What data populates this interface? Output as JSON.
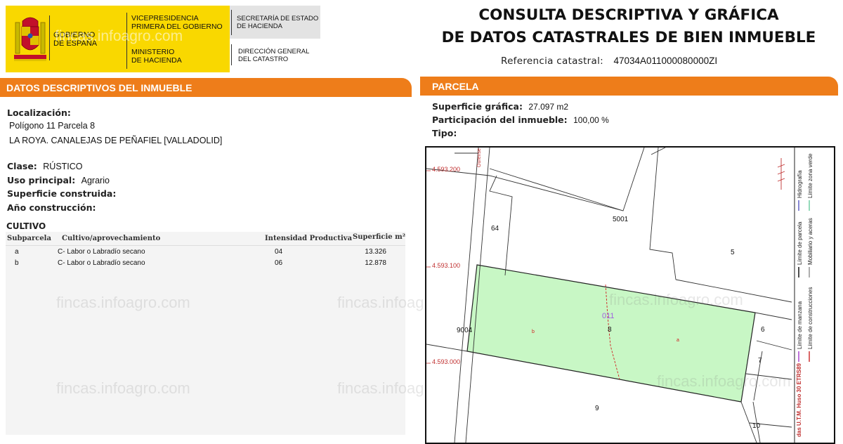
{
  "logo": {
    "gobierno_1": "GOBIERNO",
    "gobierno_2": "DE ESPAÑA",
    "vice_1": "VICEPRESIDENCIA",
    "vice_2": "PRIMERA DEL GOBIERNO",
    "min_1": "MINISTERIO",
    "min_2": "DE HACIENDA",
    "secr_1": "SECRETARÍA DE ESTADO",
    "secr_2": "DE HACIENDA",
    "dir_1": "DIRECCIÓN GENERAL",
    "dir_2": "DEL CATASTRO",
    "watermark": "fincas.infoagro.com"
  },
  "header": {
    "title_1": "CONSULTA DESCRIPTIVA Y GRÁFICA",
    "title_2": "DE DATOS CATASTRALES DE BIEN INMUEBLE",
    "ref_label": "Referencia catastral:",
    "ref_value": "47034A011000080000ZI"
  },
  "descriptivos": {
    "section_title": "DATOS DESCRIPTIVOS DEL INMUEBLE",
    "localizacion_label": "Localización:",
    "localizacion_1": "Polígono 11 Parcela 8",
    "localizacion_2": "LA ROYA. CANALEJAS DE PEÑAFIEL [VALLADOLID]",
    "clase_label": "Clase:",
    "clase_value": "RÚSTICO",
    "uso_label": "Uso principal:",
    "uso_value": "Agrario",
    "superficie_label": "Superficie construida:",
    "ano_label": "Año construcción:"
  },
  "cultivo": {
    "title": "CULTIVO",
    "headers": [
      "Subparcela",
      "Cultivo/aprovechamiento",
      "Intensidad Productiva",
      "Superficie m²"
    ],
    "rows": [
      {
        "sub": "a",
        "cultivo": "C- Labor o Labradío secano",
        "intensidad": "04",
        "superficie": "13.326"
      },
      {
        "sub": "b",
        "cultivo": "C- Labor o Labradío secano",
        "intensidad": "06",
        "superficie": "12.878"
      }
    ]
  },
  "parcela": {
    "section_title": "PARCELA",
    "sup_label": "Superficie gráfica:",
    "sup_value": "27.097 m2",
    "part_label": "Participación del inmueble:",
    "part_value": "100,00 %",
    "tipo_label": "Tipo:"
  },
  "map": {
    "y_labels": [
      "4.593.200",
      "4.593.100",
      "4.593.000"
    ],
    "parcel_labels": [
      "64",
      "5001",
      "5",
      "6",
      "7",
      "8",
      "9",
      "10",
      "9004",
      "011"
    ],
    "sub_labels": [
      "a",
      "b"
    ],
    "road_label": "Ourense",
    "legend": [
      "Límite de manzana",
      "Límite de construcciones",
      "Límite de parcela",
      "Mobiliario y aceras",
      "Hidrografía",
      "Límite zona verde"
    ],
    "coords_note": "das U.T.M. Huso 30 ETRS89",
    "parcel_fill": "#c8f7c5",
    "watermark": "fincas.infoagro.com"
  },
  "colors": {
    "accent": "#ee7d1a",
    "logo_yellow": "#f9d800"
  }
}
